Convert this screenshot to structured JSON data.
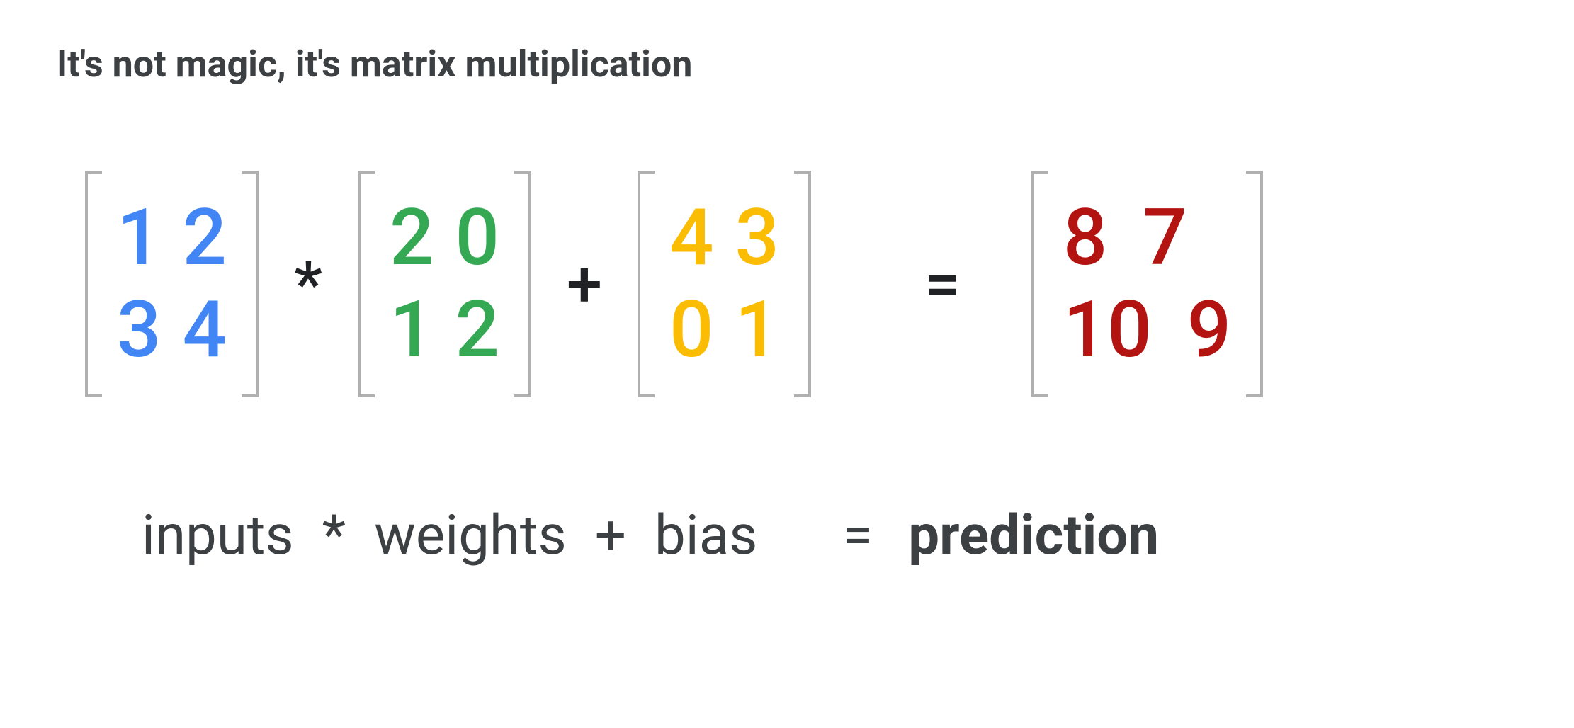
{
  "title": "It's not magic, it's matrix multiplication",
  "matrices": {
    "inputs": [
      [
        "1",
        "2"
      ],
      [
        "3",
        "4"
      ]
    ],
    "weights": [
      [
        "2",
        "0"
      ],
      [
        "1",
        "2"
      ]
    ],
    "bias": [
      [
        "4",
        "3"
      ],
      [
        "0",
        "1"
      ]
    ],
    "prediction": [
      [
        "8",
        "7"
      ],
      [
        "10",
        "9"
      ]
    ]
  },
  "operators": {
    "multiply": "*",
    "plus": "+",
    "equals": "="
  },
  "labels": {
    "inputs": "inputs",
    "multiply": "*",
    "weights": "weights",
    "plus": "+",
    "bias": "bias",
    "equals": "=",
    "prediction": "prediction"
  },
  "colors": {
    "inputs": "#4285f4",
    "weights": "#34a853",
    "bias": "#fbbc04",
    "prediction": "#b31412"
  }
}
